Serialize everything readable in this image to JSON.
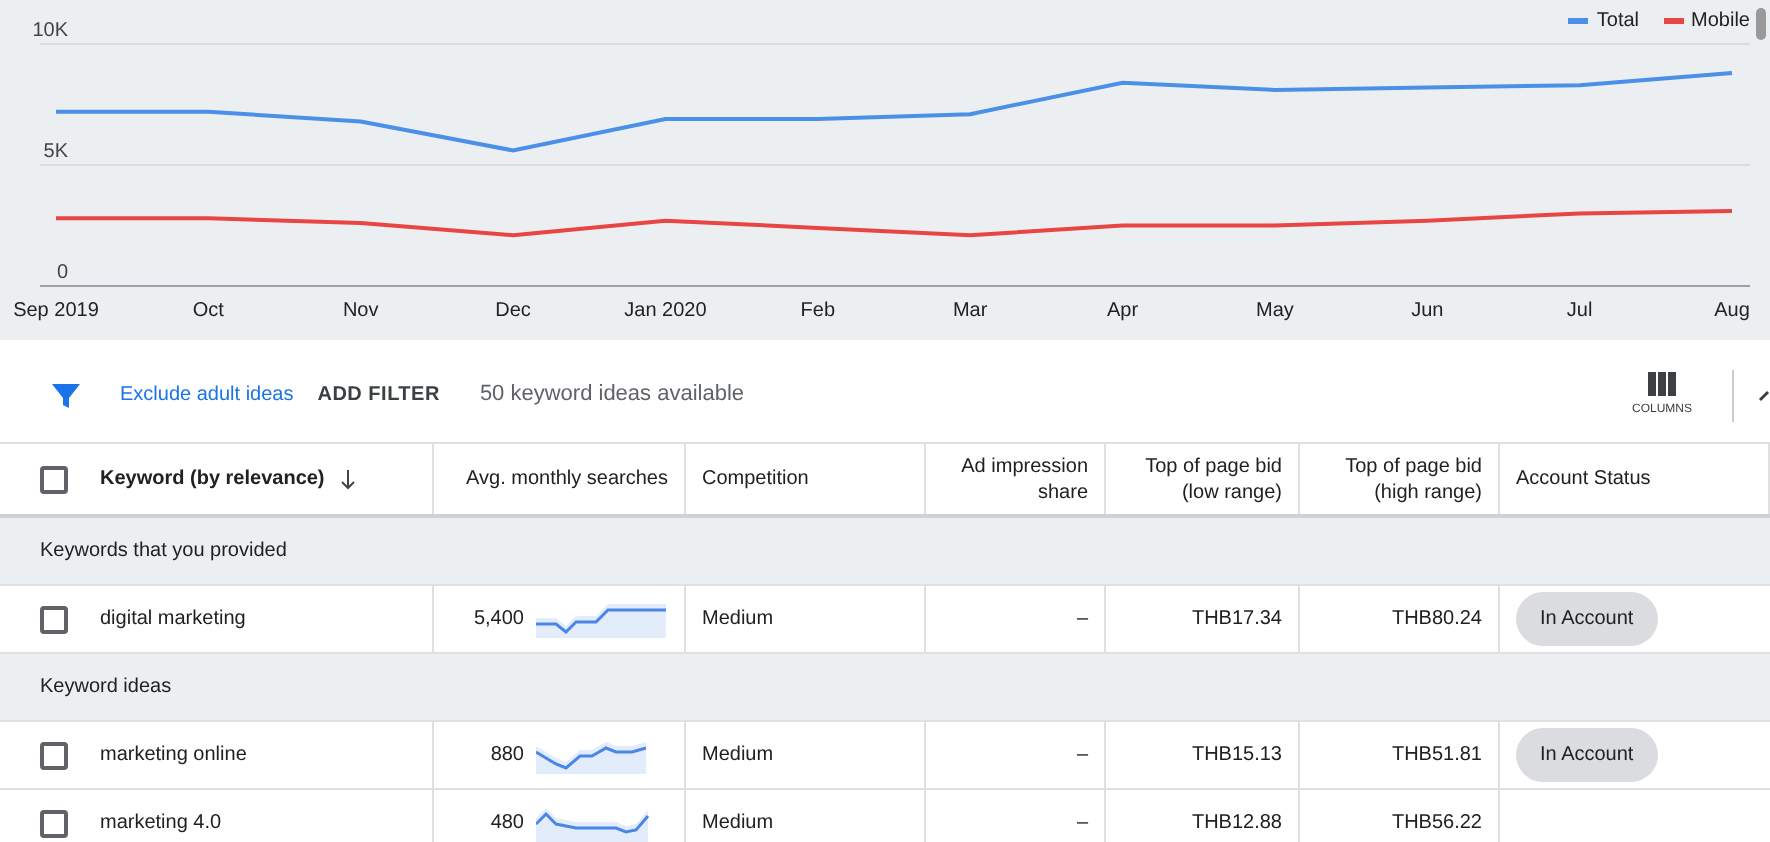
{
  "chart_data": {
    "type": "line",
    "legend": true,
    "categories": [
      "Sep 2019",
      "Oct",
      "Nov",
      "Dec",
      "Jan 2020",
      "Feb",
      "Mar",
      "Apr",
      "May",
      "Jun",
      "Jul",
      "Aug"
    ],
    "ylim": [
      0,
      10000
    ],
    "yticks": [
      {
        "value": 0,
        "label": "0"
      },
      {
        "value": 5000,
        "label": "5K"
      },
      {
        "value": 10000,
        "label": "10K"
      }
    ],
    "series": [
      {
        "name": "Total",
        "color": "#4a90e8",
        "values": [
          7200,
          7200,
          6800,
          5600,
          6900,
          6900,
          7100,
          8400,
          8100,
          8200,
          8300,
          8800
        ]
      },
      {
        "name": "Mobile",
        "color": "#e84545",
        "values": [
          2800,
          2800,
          2600,
          2100,
          2700,
          2400,
          2100,
          2500,
          2500,
          2700,
          3000,
          3100
        ]
      }
    ]
  },
  "toolbar": {
    "exclude_link": "Exclude adult ideas",
    "add_filter": "ADD FILTER",
    "count": "50 keyword ideas available",
    "columns_label": "COLUMNS"
  },
  "table": {
    "header_checked": false,
    "columns": [
      "Keyword (by relevance)",
      "Avg. monthly searches",
      "Competition",
      "Ad impression share",
      "Top of page bid (low range)",
      "Top of page bid (high range)",
      "Account Status"
    ],
    "sections": [
      {
        "title": "Keywords that you provided",
        "rows": [
          {
            "checked": false,
            "keyword": "digital marketing",
            "searches": "5,400",
            "competition": "Medium",
            "impression": "–",
            "low": "THB17.34",
            "high": "THB80.24",
            "status": "In Account"
          }
        ]
      },
      {
        "title": "Keyword ideas",
        "rows": [
          {
            "checked": false,
            "keyword": "marketing online",
            "searches": "880",
            "competition": "Medium",
            "impression": "–",
            "low": "THB15.13",
            "high": "THB51.81",
            "status": "In Account"
          },
          {
            "checked": false,
            "keyword": "marketing 4.0",
            "searches": "480",
            "competition": "Medium",
            "impression": "–",
            "low": "THB12.88",
            "high": "THB56.22"
          }
        ]
      }
    ]
  }
}
